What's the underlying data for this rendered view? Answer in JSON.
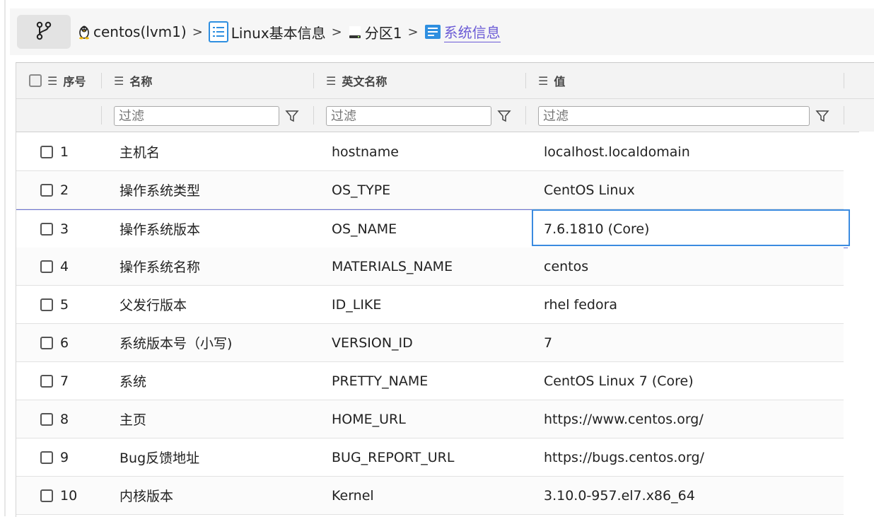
{
  "toolbar": {
    "branch_icon": "branch-icon",
    "breadcrumbs": [
      {
        "label": "centos(lvm1)",
        "icon": "linux-penguin-icon"
      },
      {
        "label": "Linux基本信息",
        "icon": "list-icon"
      },
      {
        "label": "分区1",
        "icon": "disk-icon"
      },
      {
        "label": "系统信息",
        "icon": "info-list-icon"
      }
    ],
    "separator": ">"
  },
  "table": {
    "columns": {
      "index": "序号",
      "name": "名称",
      "english": "英文名称",
      "value": "值"
    },
    "filter_placeholder": "过滤",
    "rows": [
      {
        "no": "1",
        "name": "主机名",
        "english": "hostname",
        "value": "localhost.localdomain"
      },
      {
        "no": "2",
        "name": "操作系统类型",
        "english": "OS_TYPE",
        "value": "CentOS Linux"
      },
      {
        "no": "3",
        "name": "操作系统版本",
        "english": "OS_NAME",
        "value": "7.6.1810 (Core)"
      },
      {
        "no": "4",
        "name": "操作系统名称",
        "english": "MATERIALS_NAME",
        "value": "centos"
      },
      {
        "no": "5",
        "name": "父发行版本",
        "english": "ID_LIKE",
        "value": "rhel fedora"
      },
      {
        "no": "6",
        "name": "系统版本号（小写)",
        "english": "VERSION_ID",
        "value": "7"
      },
      {
        "no": "7",
        "name": "系统",
        "english": "PRETTY_NAME",
        "value": "CentOS Linux 7 (Core)"
      },
      {
        "no": "8",
        "name": "主页",
        "english": "HOME_URL",
        "value": "https://www.centos.org/"
      },
      {
        "no": "9",
        "name": "Bug反馈地址",
        "english": "BUG_REPORT_URL",
        "value": "https://bugs.centos.org/"
      },
      {
        "no": "10",
        "name": "内核版本",
        "english": "Kernel",
        "value": "3.10.0-957.el7.x86_64"
      }
    ]
  },
  "colors": {
    "accent": "#6b5bd6",
    "focus": "#3b8be0",
    "selection": "#6a73d6"
  }
}
